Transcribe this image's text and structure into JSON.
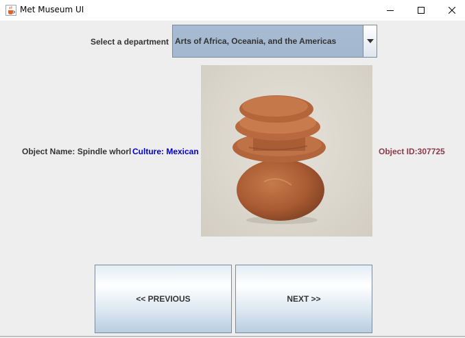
{
  "window": {
    "title": "Met Museum UI",
    "icon": "java-cup-icon"
  },
  "department": {
    "label": "Select a department",
    "selected": "Arts of Africa, Oceania, and the Americas"
  },
  "object": {
    "name_text": "Object Name: Spindle whorl",
    "culture_text": "Culture: Mexican",
    "id_text": "Object ID:307725",
    "image_alt": "Spindle whorl"
  },
  "navigation": {
    "previous_label": "<< PREVIOUS",
    "next_label": "NEXT >>"
  },
  "colors": {
    "culture": "#0000cc",
    "object_id": "#8b3a4a",
    "combo_bg": "#a3b8cf"
  }
}
